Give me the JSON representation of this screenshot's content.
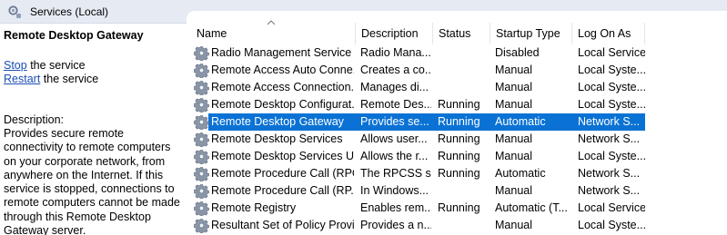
{
  "header": {
    "title": "Services (Local)"
  },
  "details": {
    "service_name": "Remote Desktop Gateway",
    "stop_link": "Stop",
    "stop_suffix": " the service",
    "restart_link": "Restart",
    "restart_suffix": " the service",
    "description_label": "Description:",
    "description_text": "Provides secure remote connectivity to remote computers on your corporate network, from anywhere on the Internet. If this service is stopped, connections to remote computers cannot be made through this Remote Desktop Gateway server."
  },
  "columns": {
    "name": "Name",
    "description": "Description",
    "status": "Status",
    "startup_type": "Startup Type",
    "log_on_as": "Log On As"
  },
  "colors": {
    "selection": "#0a72d4",
    "link": "#1a4fb5",
    "header_bg": "#e6eaf3"
  },
  "services": [
    {
      "name": "Radio Management Service",
      "description": "Radio Mana...",
      "status": "",
      "startup": "Disabled",
      "logon": "Local Service",
      "selected": false
    },
    {
      "name": "Remote Access Auto Conne...",
      "description": "Creates a co...",
      "status": "",
      "startup": "Manual",
      "logon": "Local Syste...",
      "selected": false
    },
    {
      "name": "Remote Access Connection...",
      "description": "Manages di...",
      "status": "",
      "startup": "Manual",
      "logon": "Local Syste...",
      "selected": false
    },
    {
      "name": "Remote Desktop Configurat...",
      "description": "Remote Des...",
      "status": "Running",
      "startup": "Manual",
      "logon": "Local Syste...",
      "selected": false
    },
    {
      "name": "Remote Desktop Gateway",
      "description": "Provides se...",
      "status": "Running",
      "startup": "Automatic",
      "logon": "Network S...",
      "selected": true
    },
    {
      "name": "Remote Desktop Services",
      "description": "Allows user...",
      "status": "Running",
      "startup": "Manual",
      "logon": "Network S...",
      "selected": false
    },
    {
      "name": "Remote Desktop Services U...",
      "description": "Allows the r...",
      "status": "Running",
      "startup": "Manual",
      "logon": "Local Syste...",
      "selected": false
    },
    {
      "name": "Remote Procedure Call (RPC)",
      "description": "The RPCSS s...",
      "status": "Running",
      "startup": "Automatic",
      "logon": "Network S...",
      "selected": false
    },
    {
      "name": "Remote Procedure Call (RP...",
      "description": "In Windows...",
      "status": "",
      "startup": "Manual",
      "logon": "Network S...",
      "selected": false
    },
    {
      "name": "Remote Registry",
      "description": "Enables rem...",
      "status": "Running",
      "startup": "Automatic (T...",
      "logon": "Local Service",
      "selected": false
    },
    {
      "name": "Resultant Set of Policy Provi...",
      "description": "Provides a n...",
      "status": "",
      "startup": "Manual",
      "logon": "Local Syste...",
      "selected": false
    }
  ]
}
